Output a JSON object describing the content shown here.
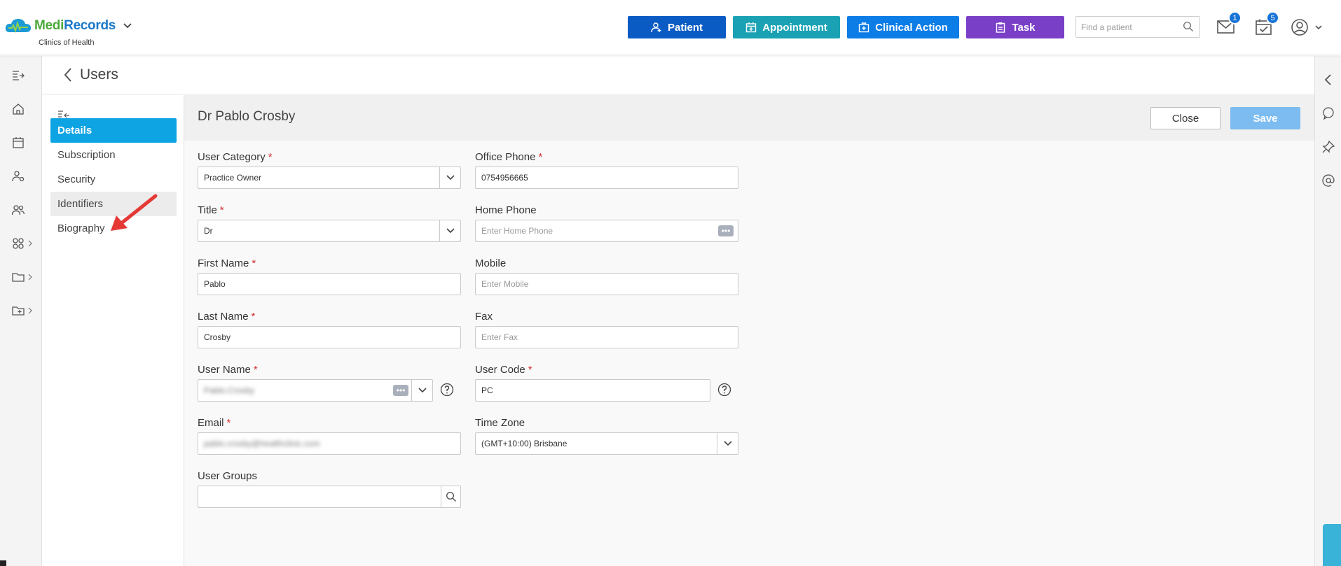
{
  "app": {
    "brand_part1": "Medi",
    "brand_part2": "Records",
    "clinic": "Clinics of Health"
  },
  "toolbar": {
    "patient_label": "Patient",
    "appointment_label": "Appointment",
    "clinical_action_label": "Clinical Action",
    "task_label": "Task",
    "search_placeholder": "Find a patient",
    "mail_count": "1",
    "tasks_count": "5"
  },
  "page": {
    "title": "Users"
  },
  "nav": {
    "items": [
      {
        "label": "Details"
      },
      {
        "label": "Subscription"
      },
      {
        "label": "Security"
      },
      {
        "label": "Identifiers"
      },
      {
        "label": "Biography"
      }
    ]
  },
  "user": {
    "heading": "Dr Pablo Crosby",
    "close_label": "Close",
    "save_label": "Save"
  },
  "form": {
    "user_category": {
      "label": "User Category",
      "value": "Practice Owner"
    },
    "office_phone": {
      "label": "Office Phone",
      "value": "0754956665"
    },
    "title": {
      "label": "Title",
      "value": "Dr"
    },
    "home_phone": {
      "label": "Home Phone",
      "placeholder": "Enter Home Phone"
    },
    "first_name": {
      "label": "First Name",
      "value": "Pablo"
    },
    "mobile": {
      "label": "Mobile",
      "placeholder": "Enter Mobile"
    },
    "last_name": {
      "label": "Last Name",
      "value": "Crosby"
    },
    "fax": {
      "label": "Fax",
      "placeholder": "Enter Fax"
    },
    "user_name": {
      "label": "User Name",
      "value": "Pablo.Crosby"
    },
    "user_code": {
      "label": "User Code",
      "value": "PC"
    },
    "email": {
      "label": "Email",
      "value": "pablo.crosby@healthclinic.com"
    },
    "time_zone": {
      "label": "Time Zone",
      "value": "(GMT+10:00) Brisbane"
    },
    "user_groups": {
      "label": "User Groups",
      "value": ""
    }
  },
  "colors": {
    "patient": "#0a5bc4",
    "appointment": "#1aa2b4",
    "clinical_action": "#0c7ce6",
    "task": "#7a3fc7",
    "active_nav": "#0ea4e3",
    "save": "#7cbcf0",
    "required": "#d32f2f",
    "annotation_arrow": "#e53935"
  }
}
